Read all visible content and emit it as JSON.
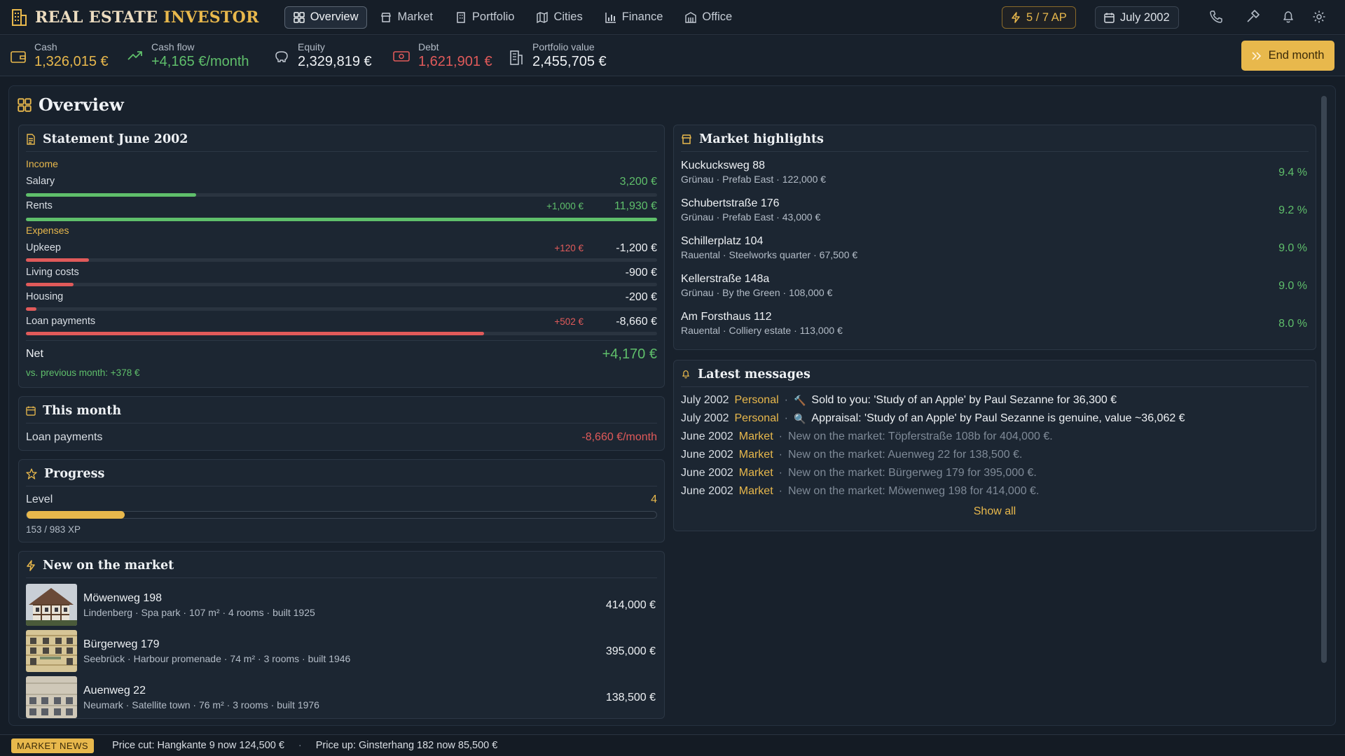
{
  "app": {
    "title_part1": "REAL ESTATE",
    "title_part2": "INVESTOR"
  },
  "nav": {
    "items": [
      {
        "label": "Overview",
        "icon": "grid-icon",
        "active": true
      },
      {
        "label": "Market",
        "icon": "store-icon"
      },
      {
        "label": "Portfolio",
        "icon": "building-icon"
      },
      {
        "label": "Cities",
        "icon": "map-icon"
      },
      {
        "label": "Finance",
        "icon": "chart-icon"
      },
      {
        "label": "Office",
        "icon": "office-icon"
      }
    ],
    "ap_label": "5 / 7 AP",
    "date_label": "July 2002"
  },
  "stats": {
    "cash_label": "Cash",
    "cash_value": "1,326,015 €",
    "cashflow_label": "Cash flow",
    "cashflow_value": "+4,165 €/month",
    "equity_label": "Equity",
    "equity_value": "2,329,819 €",
    "debt_label": "Debt",
    "debt_value": "1,621,901 €",
    "portfolio_label": "Portfolio value",
    "portfolio_value": "2,455,705 €",
    "end_month_label": "End month"
  },
  "page_title": "Overview",
  "statement": {
    "title": "Statement June 2002",
    "income_label": "Income",
    "expenses_label": "Expenses",
    "rows": {
      "salary": {
        "label": "Salary",
        "delta": "",
        "value": "3,200 €",
        "fill": 0.27
      },
      "rents": {
        "label": "Rents",
        "delta": "+1,000 €",
        "value": "11,930 €",
        "fill": 1.0
      },
      "upkeep": {
        "label": "Upkeep",
        "delta": "+120 €",
        "value": "-1,200 €",
        "fill": 0.1
      },
      "living": {
        "label": "Living costs",
        "delta": "",
        "value": "-900 €",
        "fill": 0.076
      },
      "housing": {
        "label": "Housing",
        "delta": "",
        "value": "-200 €",
        "fill": 0.017
      },
      "loan": {
        "label": "Loan payments",
        "delta": "+502 €",
        "value": "-8,660 €",
        "fill": 0.726
      }
    },
    "net_label": "Net",
    "net_value": "+4,170 €",
    "vs_previous": "vs. previous month: +378 €"
  },
  "this_month": {
    "title": "This month",
    "label": "Loan payments",
    "value": "-8,660 €/month"
  },
  "progress": {
    "title": "Progress",
    "level_label": "Level",
    "level_value": "4",
    "xp_text": "153 / 983 XP",
    "fill": 0.156
  },
  "new_on_market": {
    "title": "New on the market",
    "items": [
      {
        "name": "Möwenweg 198",
        "location": "Lindenberg · Spa park",
        "size": "107 m²",
        "rooms": "4 rooms",
        "built": "built 1925",
        "price": "414,000 €"
      },
      {
        "name": "Bürgerweg 179",
        "location": "Seebrück · Harbour promenade",
        "size": "74 m²",
        "rooms": "3 rooms",
        "built": "built 1946",
        "price": "395,000 €"
      },
      {
        "name": "Auenweg 22",
        "location": "Neumark · Satellite town",
        "size": "76 m²",
        "rooms": "3 rooms",
        "built": "built 1976",
        "price": "138,500 €"
      }
    ]
  },
  "highlights": {
    "title": "Market highlights",
    "items": [
      {
        "name": "Kuckucksweg 88",
        "location": "Grünau · Prefab East",
        "price": "122,000 €",
        "yield": "9.4 %"
      },
      {
        "name": "Schubertstraße 176",
        "location": "Grünau · Prefab East",
        "price": "43,000 €",
        "yield": "9.2 %"
      },
      {
        "name": "Schillerplatz 104",
        "location": "Rauental · Steelworks quarter",
        "price": "67,500 €",
        "yield": "9.0 %"
      },
      {
        "name": "Kellerstraße 148a",
        "location": "Grünau · By the Green",
        "price": "108,000 €",
        "yield": "9.0 %"
      },
      {
        "name": "Am Forsthaus 112",
        "location": "Rauental · Colliery estate",
        "price": "113,000 €",
        "yield": "8.0 %"
      }
    ]
  },
  "messages": {
    "title": "Latest messages",
    "items": [
      {
        "date": "July 2002",
        "category": "Personal",
        "icon": "🔨",
        "text": "Sold to you: 'Study of an Apple' by Paul Sezanne for 36,300 €",
        "dim": false
      },
      {
        "date": "July 2002",
        "category": "Personal",
        "icon": "🔍",
        "text": "Appraisal: 'Study of an Apple' by Paul Sezanne is genuine, value ~36,062 €",
        "dim": false
      },
      {
        "date": "June 2002",
        "category": "Market",
        "icon": "",
        "text": "New on the market: Töpferstraße 108b for 404,000 €.",
        "dim": true
      },
      {
        "date": "June 2002",
        "category": "Market",
        "icon": "",
        "text": "New on the market: Auenweg 22 for 138,500 €.",
        "dim": true
      },
      {
        "date": "June 2002",
        "category": "Market",
        "icon": "",
        "text": "New on the market: Bürgerweg 179 for 395,000 €.",
        "dim": true
      },
      {
        "date": "June 2002",
        "category": "Market",
        "icon": "",
        "text": "New on the market: Möwenweg 198 for 414,000 €.",
        "dim": true
      }
    ],
    "show_all": "Show all"
  },
  "ticker": {
    "badge": "MARKET NEWS",
    "items": [
      "Price cut: Hangkante 9 now 124,500 €",
      "Price up: Ginsterhang 182 now 85,500 €"
    ]
  },
  "colors": {
    "accent": "#e8b84c",
    "positive": "#5fbf6b",
    "negative": "#e05a5a",
    "background": "#151d27",
    "panel": "#1c2632"
  }
}
